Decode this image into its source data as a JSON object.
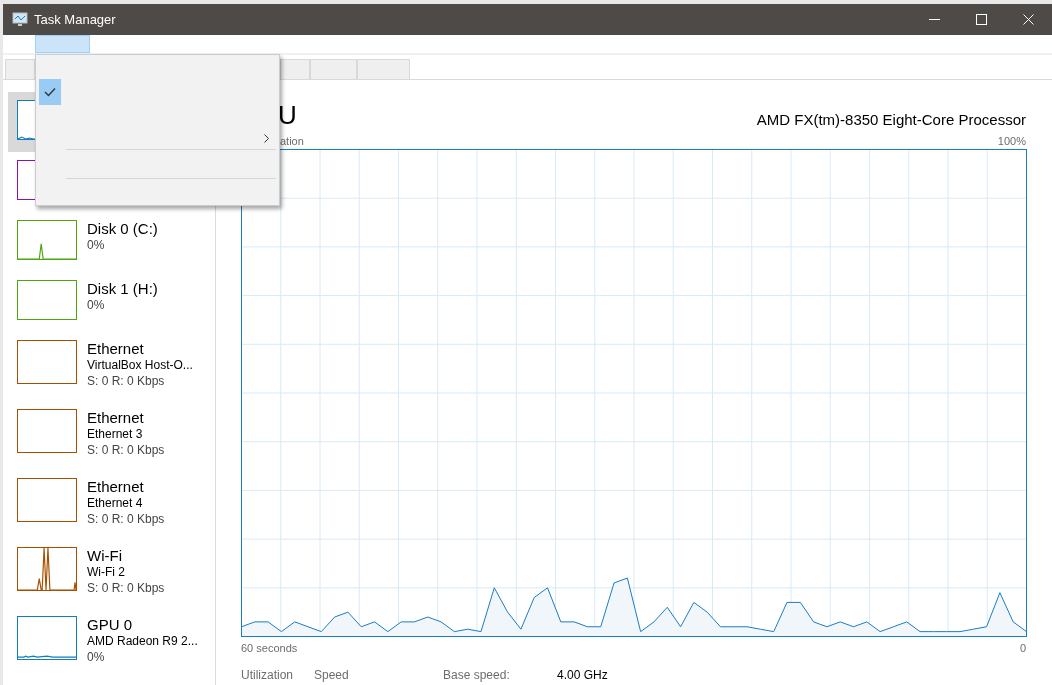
{
  "window": {
    "title": "Task Manager"
  },
  "menu_bar": [
    {
      "open": true
    }
  ],
  "tabs": [
    {
      "selected": false
    },
    {
      "selected": false
    },
    {
      "selected": false
    },
    {
      "selected": false
    }
  ],
  "menu": {
    "items": [
      {
        "kind": "item",
        "checked": false,
        "submenu": false
      },
      {
        "kind": "item",
        "checked": true,
        "submenu": false
      },
      {
        "kind": "item",
        "checked": false,
        "submenu": false
      },
      {
        "kind": "item",
        "checked": false,
        "submenu": true
      },
      {
        "kind": "separator"
      },
      {
        "kind": "item",
        "checked": false,
        "submenu": false
      },
      {
        "kind": "separator"
      },
      {
        "kind": "item",
        "checked": false,
        "submenu": false
      }
    ]
  },
  "sidebar": {
    "items": [
      {
        "selected": true,
        "color": "#117dbb"
      },
      {
        "selected": false,
        "color": "#8b12ae"
      },
      {
        "selected": false,
        "color": "#4da60c",
        "title": "Disk 0 (C:)",
        "reading": "0%"
      },
      {
        "selected": false,
        "color": "#4da60c",
        "title": "Disk 1 (H:)",
        "reading": "0%"
      },
      {
        "selected": false,
        "color": "#a74f01",
        "title": "Ethernet",
        "subtitle": "VirtualBox Host-O...",
        "reading": "S: 0 R: 0 Kbps"
      },
      {
        "selected": false,
        "color": "#a74f01",
        "title": "Ethernet",
        "subtitle": "Ethernet 3",
        "reading": "S: 0 R: 0 Kbps"
      },
      {
        "selected": false,
        "color": "#a74f01",
        "title": "Ethernet",
        "subtitle": "Ethernet 4",
        "reading": "S: 0 R: 0 Kbps"
      },
      {
        "selected": false,
        "color": "#a74f01",
        "title": "Wi-Fi",
        "subtitle": "Wi-Fi 2",
        "reading": "S: 0 R: 0 Kbps"
      },
      {
        "selected": false,
        "color": "#117dbb",
        "title": "GPU 0",
        "subtitle": "AMD Radeon R9 2...",
        "reading": "0%"
      }
    ]
  },
  "performance": {
    "title": "U",
    "processor": "AMD FX(tm)-8350 Eight-Core Processor",
    "graph_label": "ation",
    "graph_max": "100%",
    "graph_time": "60 seconds",
    "graph_min": "0",
    "stats": [
      {
        "label": "Utilization"
      },
      {
        "label": "Speed"
      },
      {
        "label": "Base speed:",
        "value": "4.00 GHz"
      }
    ]
  }
}
